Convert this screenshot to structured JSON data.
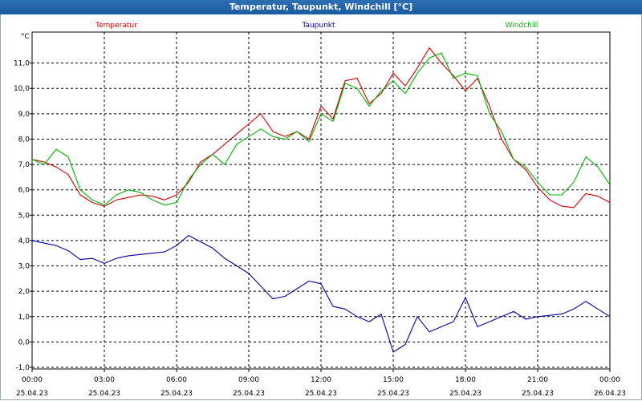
{
  "window": {
    "title": "Temperatur, Taupunkt, Windchill [°C]"
  },
  "chart_data": {
    "type": "line",
    "title": "Temperatur, Taupunkt, Windchill [°C]",
    "ylabel": "°C",
    "ylim": [
      -1.0,
      12.0
    ],
    "yticks": [
      "-1,0",
      "0,0",
      "1,0",
      "2,0",
      "3,0",
      "4,0",
      "5,0",
      "6,0",
      "7,0",
      "8,0",
      "9,0",
      "10,0",
      "11,0"
    ],
    "xlim": [
      "2023-04-25 00:00",
      "2023-04-26 00:00"
    ],
    "xticks": [
      {
        "time": "00:00",
        "date": "25.04.23"
      },
      {
        "time": "03:00",
        "date": "25.04.23"
      },
      {
        "time": "06:00",
        "date": "25.04.23"
      },
      {
        "time": "09:00",
        "date": "25.04.23"
      },
      {
        "time": "12:00",
        "date": "25.04.23"
      },
      {
        "time": "15:00",
        "date": "25.04.23"
      },
      {
        "time": "18:00",
        "date": "25.04.23"
      },
      {
        "time": "21:00",
        "date": "25.04.23"
      },
      {
        "time": "00:00",
        "date": "26.04.23"
      }
    ],
    "grid": true,
    "legend_position": "top",
    "x": [
      "00:00",
      "00:30",
      "01:00",
      "01:30",
      "02:00",
      "02:30",
      "03:00",
      "03:30",
      "04:00",
      "04:30",
      "05:00",
      "05:30",
      "06:00",
      "06:30",
      "07:00",
      "07:30",
      "08:00",
      "08:30",
      "09:00",
      "09:30",
      "10:00",
      "10:30",
      "11:00",
      "11:30",
      "12:00",
      "12:30",
      "13:00",
      "13:30",
      "14:00",
      "14:30",
      "15:00",
      "15:30",
      "16:00",
      "16:30",
      "17:00",
      "17:30",
      "18:00",
      "18:30",
      "19:00",
      "19:30",
      "20:00",
      "20:30",
      "21:00",
      "21:30",
      "22:00",
      "22:30",
      "23:00",
      "23:30",
      "24:00"
    ],
    "series": [
      {
        "name": "Temperatur",
        "color": "#d40000",
        "values": [
          7.2,
          7.1,
          6.9,
          6.6,
          5.8,
          5.5,
          5.35,
          5.6,
          5.7,
          5.8,
          5.75,
          5.6,
          5.8,
          6.3,
          7.1,
          7.4,
          7.8,
          8.2,
          8.6,
          9.0,
          8.3,
          8.1,
          8.3,
          8.0,
          9.3,
          8.8,
          10.3,
          10.4,
          9.4,
          9.8,
          10.6,
          10.1,
          10.8,
          11.6,
          11.0,
          10.5,
          9.9,
          10.4,
          9.3,
          8.0,
          7.2,
          6.8,
          6.1,
          5.6,
          5.35,
          5.3,
          5.85,
          5.75,
          5.5
        ]
      },
      {
        "name": "Taupunkt",
        "color": "#0000a0",
        "values": [
          4.0,
          3.9,
          3.8,
          3.6,
          3.25,
          3.3,
          3.1,
          3.3,
          3.4,
          3.45,
          3.5,
          3.55,
          3.8,
          4.2,
          3.95,
          3.7,
          3.3,
          3.0,
          2.7,
          2.2,
          1.7,
          1.8,
          2.1,
          2.4,
          2.3,
          1.4,
          1.3,
          1.0,
          0.8,
          1.1,
          -0.4,
          -0.1,
          1.0,
          0.4,
          0.6,
          0.8,
          1.75,
          0.6,
          0.8,
          1.0,
          1.2,
          0.9,
          1.0,
          1.05,
          1.1,
          1.3,
          1.6,
          1.3,
          1.0
        ]
      },
      {
        "name": "Windchill",
        "color": "#00b400",
        "values": [
          7.2,
          7.0,
          7.6,
          7.3,
          6.0,
          5.6,
          5.4,
          5.8,
          6.0,
          5.9,
          5.6,
          5.4,
          5.5,
          6.4,
          7.0,
          7.4,
          7.0,
          7.8,
          8.1,
          8.4,
          8.1,
          8.0,
          8.3,
          7.9,
          9.0,
          8.7,
          10.2,
          10.0,
          9.3,
          9.9,
          10.3,
          9.8,
          10.6,
          11.2,
          11.4,
          10.4,
          10.6,
          10.5,
          9.0,
          8.3,
          7.2,
          6.9,
          6.3,
          5.8,
          5.8,
          6.3,
          7.3,
          6.9,
          6.2
        ]
      }
    ]
  }
}
